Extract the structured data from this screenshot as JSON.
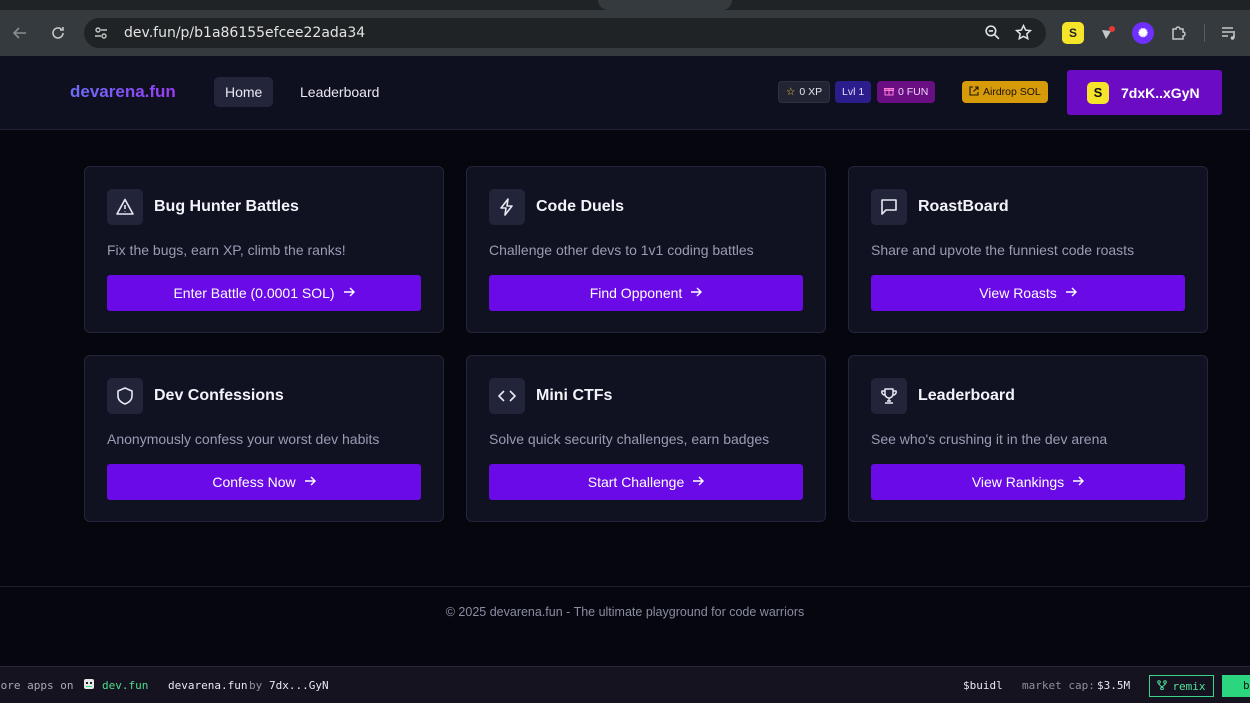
{
  "browser": {
    "url": "dev.fun/p/b1a86155efcee22ada34"
  },
  "header": {
    "logo": "devarena.fun",
    "nav": [
      {
        "label": "Home"
      },
      {
        "label": "Leaderboard"
      }
    ],
    "xp": "0 XP",
    "level": "Lvl 1",
    "fun": "0 FUN",
    "airdrop": "Airdrop SOL",
    "wallet": "7dxK..xGyN"
  },
  "cards": [
    {
      "title": "Bug Hunter Battles",
      "icon": "alert-triangle-icon",
      "description": "Fix the bugs, earn XP, climb the ranks!",
      "button": "Enter Battle (0.0001 SOL)"
    },
    {
      "title": "Code Duels",
      "icon": "lightning-icon",
      "description": "Challenge other devs to 1v1 coding battles",
      "button": "Find Opponent"
    },
    {
      "title": "RoastBoard",
      "icon": "message-square-icon",
      "description": "Share and upvote the funniest code roasts",
      "button": "View Roasts"
    },
    {
      "title": "Dev Confessions",
      "icon": "shield-icon",
      "description": "Anonymously confess your worst dev habits",
      "button": "Confess Now"
    },
    {
      "title": "Mini CTFs",
      "icon": "code-icon",
      "description": "Solve quick security challenges, earn badges",
      "button": "Start Challenge"
    },
    {
      "title": "Leaderboard",
      "icon": "trophy-icon",
      "description": "See who's crushing it in the dev arena",
      "button": "View Rankings"
    }
  ],
  "footer": {
    "text": "© 2025 devarena.fun - The ultimate playground for code warriors"
  },
  "bottom_bar": {
    "explore": "lore apps on",
    "devfun": "dev.fun",
    "app": "devarena.fun",
    "by": "by",
    "author": "7dx...GyN",
    "token": "$buidl",
    "mcap_label": "market cap:",
    "mcap_value": "$3.5M",
    "remix": "remix",
    "cta": "b"
  },
  "colors": {
    "accent": "#6a0ae6",
    "wallet": "#6c0bc4",
    "airdrop": "#d79b0a",
    "background": "#05060e",
    "card": "#101222"
  }
}
